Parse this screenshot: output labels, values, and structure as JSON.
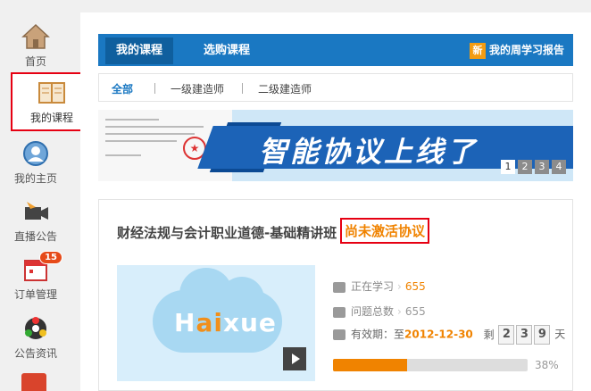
{
  "sidebar": {
    "items": [
      {
        "label": "首页",
        "icon": "home-icon"
      },
      {
        "label": "我的课程",
        "icon": "book-icon"
      },
      {
        "label": "我的主页",
        "icon": "user-icon"
      },
      {
        "label": "直播公告",
        "icon": "video-camera-icon"
      },
      {
        "label": "订单管理",
        "icon": "calendar-icon",
        "badge": "15"
      },
      {
        "label": "公告资讯",
        "icon": "news-icon"
      }
    ]
  },
  "topbar": {
    "tabs": [
      "我的课程",
      "选购课程"
    ],
    "report_badge": "新",
    "report_label": "我的周学习报告"
  },
  "filters": [
    "全部",
    "一级建造师",
    "二级建造师"
  ],
  "banner": {
    "headline": "智能协议上线了",
    "pages": [
      "1",
      "2",
      "3",
      "4"
    ],
    "stamp": "★"
  },
  "course": {
    "title": "财经法规与会计职业道德-基础精讲班",
    "status": "尚未激活协议",
    "thumb_brand_1": "H",
    "thumb_brand_2": "ai",
    "thumb_brand_3": "xue",
    "studying_label": "正在学习",
    "studying_count": "655",
    "questions_label": "问题总数",
    "questions_count": "655",
    "validity_label": "有效期：至",
    "validity_date": "2012-12-30",
    "remaining_label": "剩",
    "remaining_digits": [
      "2",
      "3",
      "9"
    ],
    "remaining_unit": "天",
    "progress_percent": 38,
    "progress_label": "38%"
  },
  "colors": {
    "primary": "#1a78c2",
    "accent": "#f08300",
    "highlight_border": "#e60012"
  }
}
